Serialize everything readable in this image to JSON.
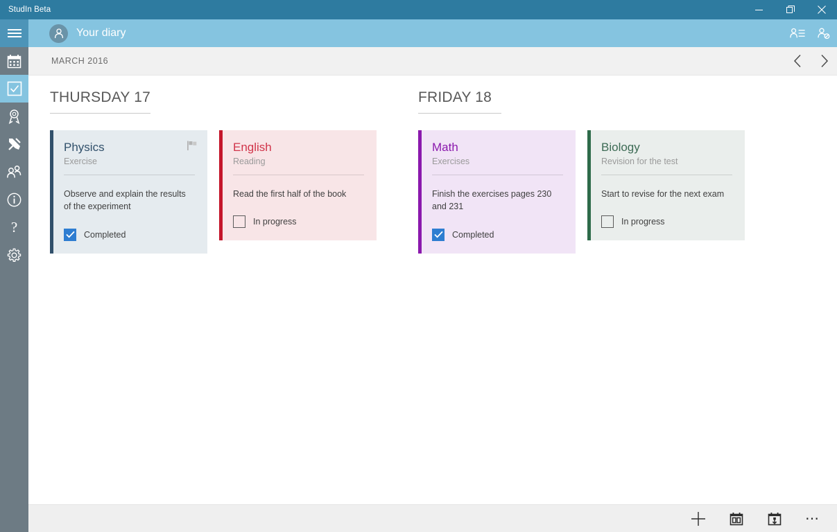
{
  "window": {
    "title": "StudIn Beta",
    "controls": [
      {
        "name": "minimize",
        "label": "─"
      },
      {
        "name": "restore",
        "label": "❐"
      },
      {
        "name": "close",
        "label": "✕"
      }
    ]
  },
  "sidebar": {
    "menu_label": "Menu",
    "items": [
      {
        "icon": "calendar-icon",
        "label": "Calendar",
        "active": false
      },
      {
        "icon": "checkbox-icon",
        "label": "Diary",
        "active": true
      },
      {
        "icon": "award-icon",
        "label": "Grades",
        "active": false
      },
      {
        "icon": "tools-icon",
        "label": "Tools",
        "active": false
      },
      {
        "icon": "people-icon",
        "label": "Classmates",
        "active": false
      },
      {
        "icon": "info-icon",
        "label": "Information",
        "active": false
      },
      {
        "icon": "help-icon",
        "label": "Help",
        "active": false
      },
      {
        "icon": "gear-icon",
        "label": "Settings",
        "active": false
      }
    ]
  },
  "header": {
    "avatar_icon": "person-icon",
    "title": "Your diary",
    "actions": [
      {
        "icon": "contact-list-icon",
        "label": "Contacts"
      },
      {
        "icon": "person-block-icon",
        "label": "Account"
      }
    ]
  },
  "monthbar": {
    "month": "MARCH 2016",
    "prev_label": "Previous",
    "next_label": "Next"
  },
  "days": [
    {
      "title": "THURSDAY 17",
      "cards": [
        {
          "subject": "Physics",
          "type": "Exercise",
          "description": "Observe and explain the results of the experiment",
          "status": "Completed",
          "checked": true,
          "flagged": true,
          "accent": "#31506b",
          "background": "#e5ebef",
          "title_color": "#31506b"
        },
        {
          "subject": "English",
          "type": "Reading",
          "description": "Read the first half of the book",
          "status": "In progress",
          "checked": false,
          "flagged": false,
          "accent": "#c4162b",
          "background": "#f8e5e7",
          "title_color": "#d1344a"
        }
      ]
    },
    {
      "title": "FRIDAY 18",
      "cards": [
        {
          "subject": "Math",
          "type": "Exercises",
          "description": "Finish the exercises pages 230 and 231",
          "status": "Completed",
          "checked": true,
          "flagged": false,
          "accent": "#8b19ad",
          "background": "#f1e4f6",
          "title_color": "#8b19ad"
        },
        {
          "subject": "Biology",
          "type": "Revision for the test",
          "description": "Start to revise for the next exam",
          "status": "In progress",
          "checked": false,
          "flagged": false,
          "accent": "#2e6b4a",
          "background": "#eaeeec",
          "title_color": "#3d6b55"
        }
      ]
    }
  ],
  "bottombar": {
    "actions": [
      {
        "icon": "plus-icon",
        "label": "Add"
      },
      {
        "icon": "calendar-week-icon",
        "label": "Week view"
      },
      {
        "icon": "calendar-today-icon",
        "label": "Today"
      },
      {
        "icon": "more-icon",
        "label": "More"
      }
    ]
  }
}
